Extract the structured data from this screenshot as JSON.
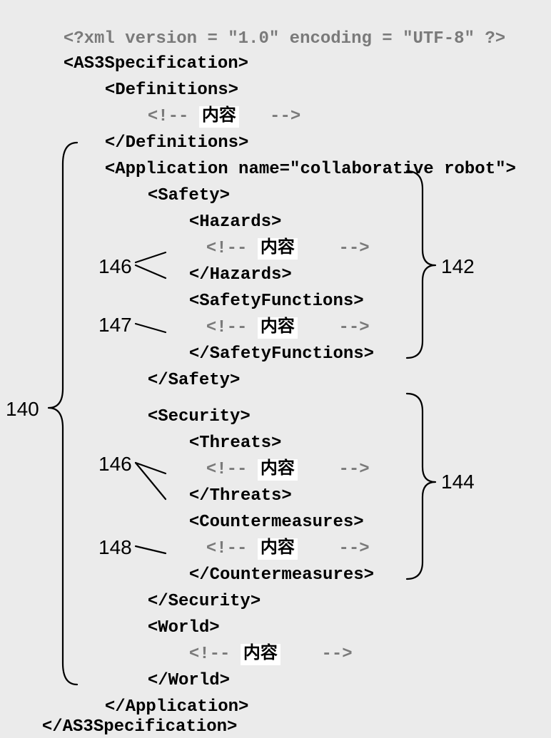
{
  "lines": {
    "l1_pre": "<?xml version = ",
    "l1_ver": "\"1.0\"",
    "l1_mid": " encoding = ",
    "l1_enc": "\"UTF-8\"",
    "l1_end": " ?>",
    "l2": "<AS3Specification>",
    "l3": "<Definitions>",
    "l4_open": "<!-- ",
    "l4_content": "内容",
    "l4_close": "-->",
    "l5": "</Definitions>",
    "l6": "<Application name=\"collaborative robot\">",
    "l7": "<Safety>",
    "l8": "<Hazards>",
    "l9_open": "<!-- ",
    "l9_content": "内容",
    "l9_close": "-->",
    "l10": "</Hazards>",
    "l11": "<SafetyFunctions>",
    "l12_open": "<!-- ",
    "l12_content": "内容",
    "l12_close": "-->",
    "l13": "</SafetyFunctions>",
    "l14": "</Safety>",
    "l15": "<Security>",
    "l16": "<Threats>",
    "l17_open": "<!-- ",
    "l17_content": "内容",
    "l17_close": "-->",
    "l18": "</Threats>",
    "l19": "<Countermeasures>",
    "l20_open": "<!-- ",
    "l20_content": "内容",
    "l20_close": "-->",
    "l21": "</Countermeasures>",
    "l22": "</Security>",
    "l23": "<World>",
    "l24_open": "<!-- ",
    "l24_content": "内容",
    "l24_close": "-->",
    "l25": "</World>",
    "l26": "</Application>",
    "l27": "</AS3Specification>"
  },
  "refs": {
    "r140": "140",
    "r142": "142",
    "r144": "144",
    "r146a": "146",
    "r146b": "146",
    "r147": "147",
    "r148": "148"
  }
}
